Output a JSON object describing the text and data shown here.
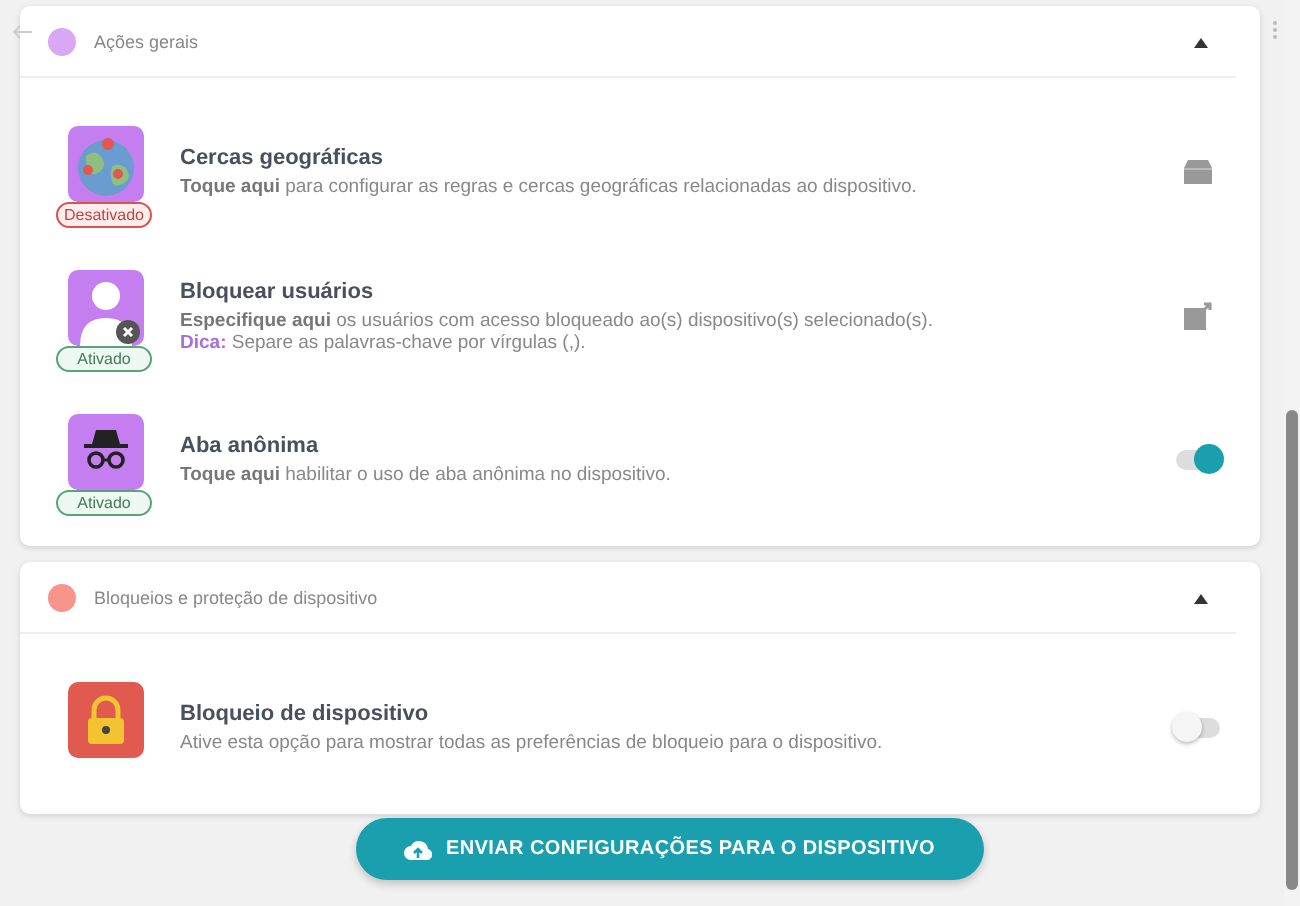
{
  "sections": [
    {
      "title": "Ações gerais",
      "color": "#d9a8f5",
      "expanded": true,
      "items": [
        {
          "kind": "action",
          "title": "Cercas geográficas",
          "description": "**Toque aqui** para configurar as regras e cercas geográficas relacionadas ao dispositivo.",
          "badge": "Desativado",
          "enabled": false
        },
        {
          "kind": "action",
          "title": "Bloquear usuários",
          "description": "**Especifique aqui** os usuários com acesso bloqueado ao(s) dispositivo(s) selecionado(s).",
          "hint_label": "Dica:",
          "hint": "Separe as palavras-chave por vírgulas (,).",
          "badge": "Ativado",
          "enabled": true
        },
        {
          "kind": "toggle",
          "title": "Aba anônima",
          "description": "**Toque aqui** habilitar o uso de aba anônima no dispositivo.",
          "badge": "Ativado",
          "enabled": true,
          "on": true
        }
      ]
    },
    {
      "title": "Bloqueios e proteção de dispositivo",
      "color": "#f7948c",
      "expanded": true,
      "items": [
        {
          "kind": "toggle",
          "title": "Bloqueio de dispositivo",
          "description": "Ative esta opção para mostrar todas as preferências de bloqueio para o dispositivo.",
          "on": false
        }
      ]
    }
  ],
  "send_button": "ENVIAR CONFIGURAÇÕES PARA O DISPOSITIVO"
}
